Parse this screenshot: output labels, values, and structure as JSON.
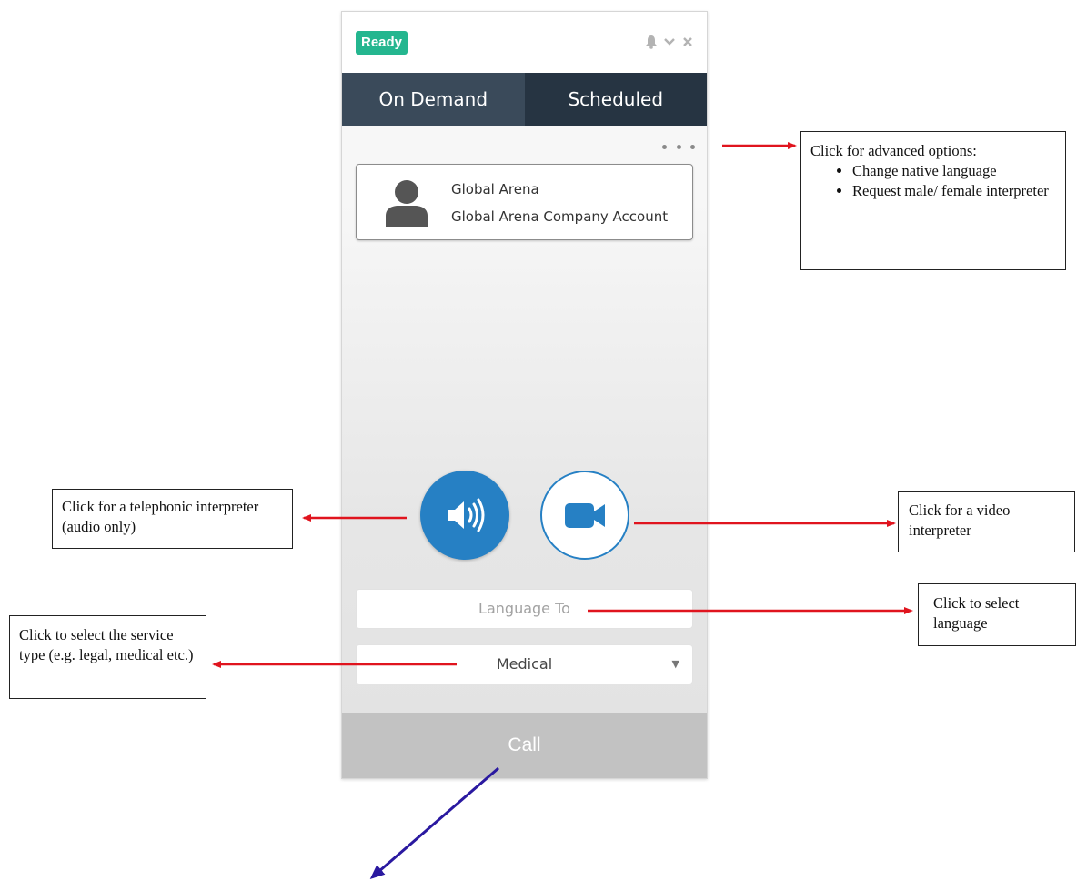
{
  "widget": {
    "status": "Ready",
    "tabs": [
      {
        "label": "On Demand",
        "active": true
      },
      {
        "label": "Scheduled",
        "active": false
      }
    ],
    "account": {
      "name": "Global Arena",
      "company": "Global Arena Company Account"
    },
    "language_placeholder": "Language To",
    "service_type": "Medical",
    "call_label": "Call",
    "icons": [
      "bell-icon",
      "chevron-down-icon",
      "close-icon",
      "more-options-icon",
      "user-icon",
      "speaker-icon",
      "video-camera-icon",
      "caret-down-icon"
    ]
  },
  "annotations": {
    "advanced": {
      "title": "Click for advanced options:",
      "items": [
        "Change native language",
        "Request male/ female interpreter"
      ]
    },
    "audio": "Click for a telephonic interpreter (audio only)",
    "video": "Click for a video interpreter",
    "language": "Click to select language",
    "service": "Click to select the service type (e.g. legal, medical etc.)"
  },
  "colors": {
    "ready_green": "#24b68f",
    "tab_dark": "#263442",
    "tab_active": "#3a4a5a",
    "accent_blue": "#2680c4",
    "call_gray": "#c2c2c2",
    "arrow_red": "#e0141e",
    "arrow_purple": "#2a19a0"
  }
}
